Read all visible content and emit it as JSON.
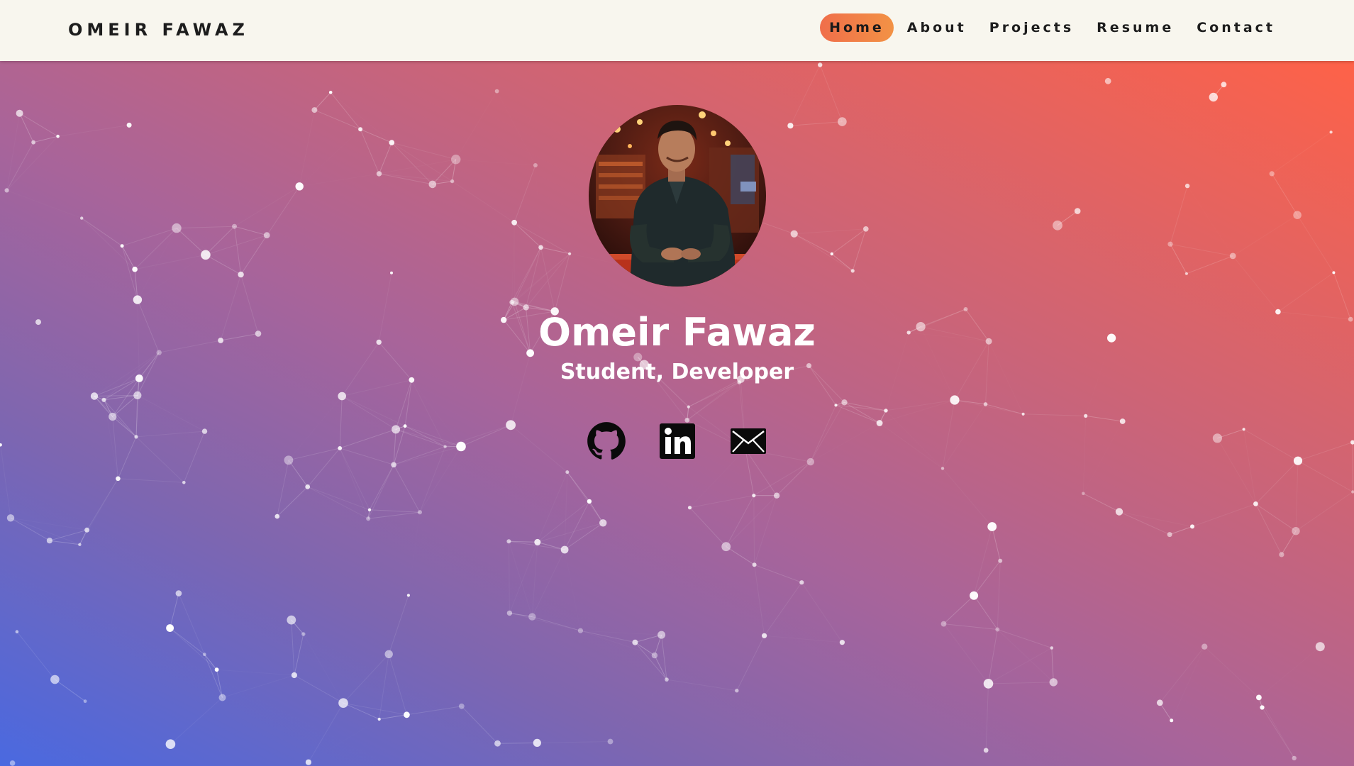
{
  "brand": {
    "name": "OMEIR FAWAZ"
  },
  "nav": {
    "items": [
      {
        "label": "Home",
        "active": true
      },
      {
        "label": "About",
        "active": false
      },
      {
        "label": "Projects",
        "active": false
      },
      {
        "label": "Resume",
        "active": false
      },
      {
        "label": "Contact",
        "active": false
      }
    ]
  },
  "hero": {
    "name": "Omeir Fawaz",
    "tagline": "Student, Developer",
    "avatar_icon": "profile-photo",
    "socials": [
      {
        "icon": "github-icon"
      },
      {
        "icon": "linkedin-icon"
      },
      {
        "icon": "email-icon"
      }
    ]
  },
  "colors": {
    "nav_background": "#f8f6ee",
    "nav_active": "#f07a48",
    "gradient_start": "#4a69e0",
    "gradient_end": "#fe6248",
    "text_light": "#ffffff",
    "text_dark": "#1d1d1d"
  }
}
